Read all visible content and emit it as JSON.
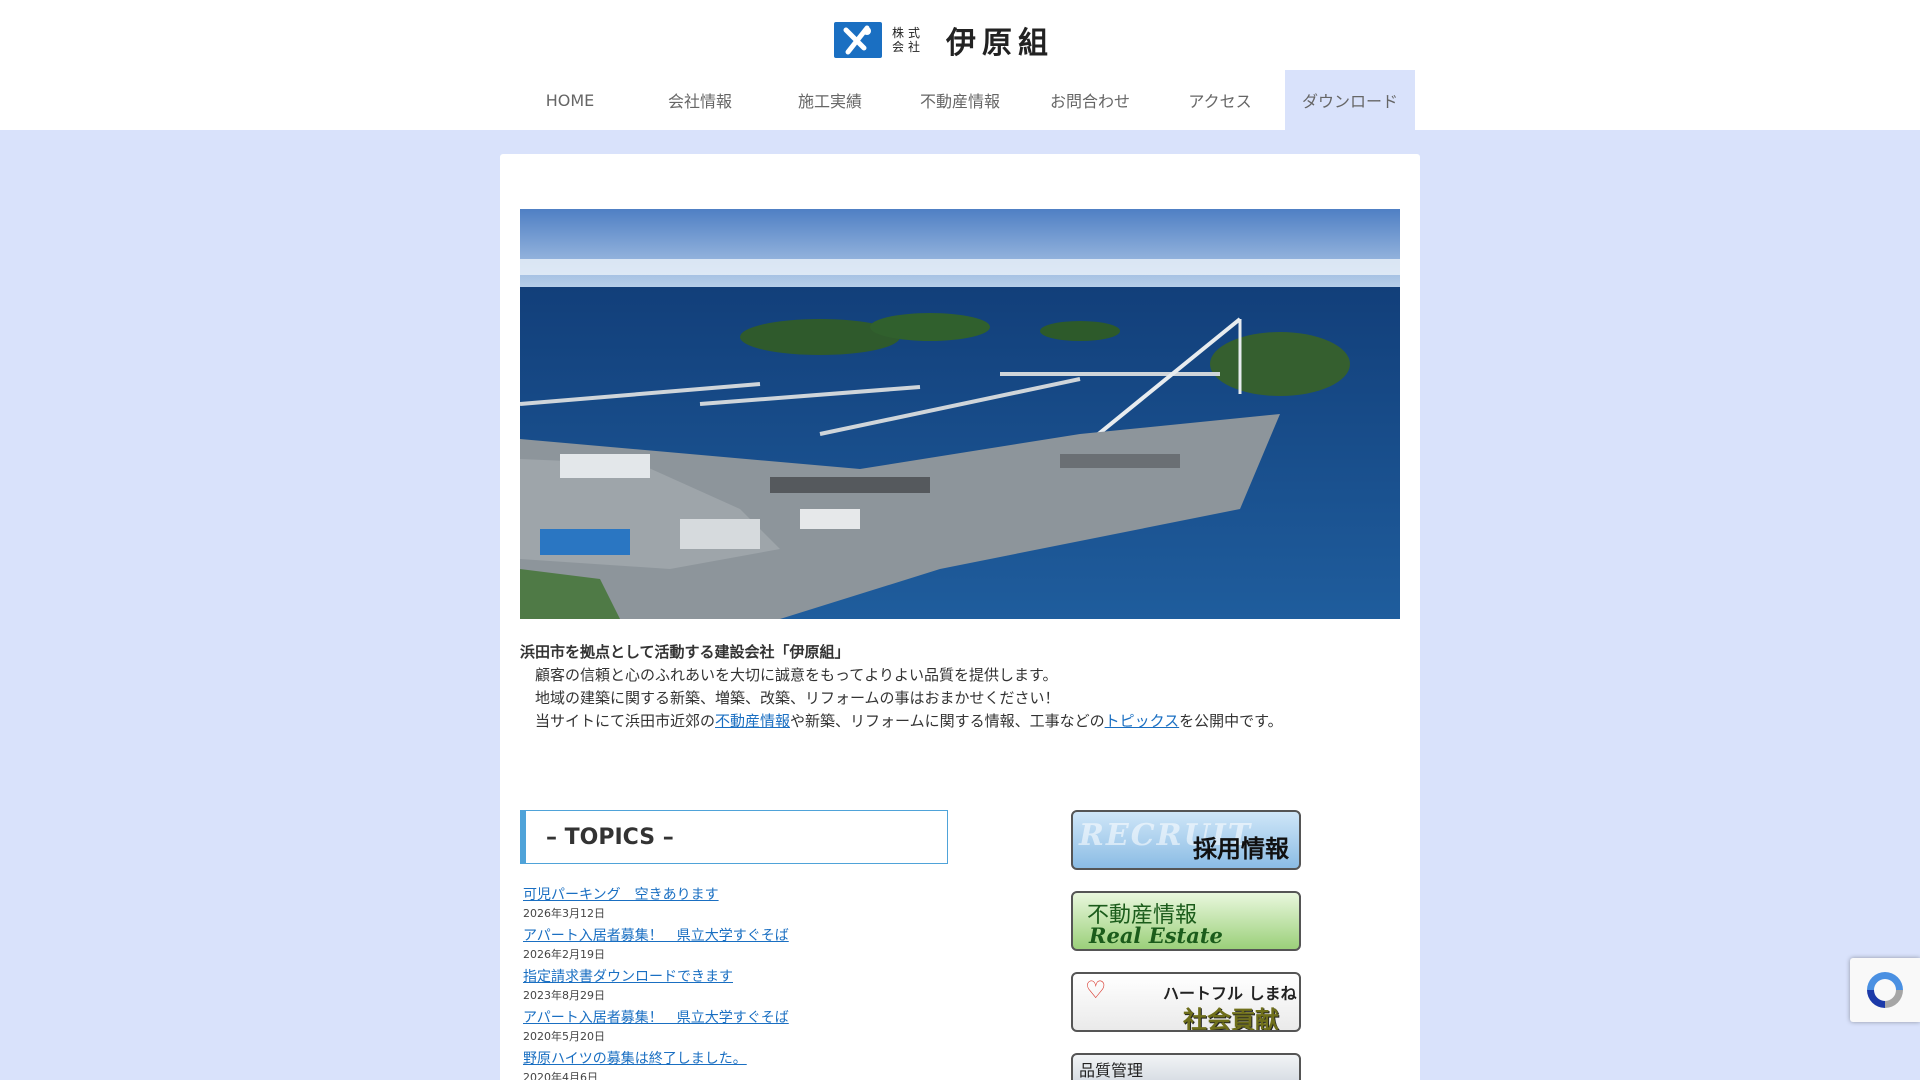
{
  "header": {
    "logo": {
      "kk_line1": "株式",
      "kk_line2": "会社",
      "name": "伊原組"
    },
    "nav": [
      {
        "label": "HOME",
        "active": false
      },
      {
        "label": "会社情報",
        "active": false
      },
      {
        "label": "施工実績",
        "active": false
      },
      {
        "label": "不動産情報",
        "active": false
      },
      {
        "label": "お問合わせ",
        "active": false
      },
      {
        "label": "アクセス",
        "active": false
      },
      {
        "label": "ダウンロード",
        "active": true
      }
    ]
  },
  "intro": {
    "lead": "浜田市を拠点として活動する建設会社「伊原組」",
    "line1": "顧客の信頼と心のふれあいを大切に誠意をもってよりよい品質を提供します。",
    "line2": "地域の建築に関する新築、増築、改築、リフォームの事はおまかせください！",
    "line3_part1": "当サイトにて浜田市近郊の",
    "line3_link1": "不動産情報",
    "line3_part2": "や新築、リフォームに関する情報、工事などの",
    "line3_link2": "トピックス",
    "line3_part3": "を公開中です。"
  },
  "topics": {
    "heading": "– TOPICS –",
    "items": [
      {
        "title": "可児パーキング　空きあります",
        "date": "2026年3月12日"
      },
      {
        "title": "アパート入居者募集！　県立大学すぐそば",
        "date": "2026年2月19日"
      },
      {
        "title": "指定請求書ダウンロードできます",
        "date": "2023年8月29日"
      },
      {
        "title": "アパート入居者募集！　県立大学すぐそば",
        "date": "2020年5月20日"
      },
      {
        "title": "野原ハイツの募集は終了しました。",
        "date": "2020年4月6日"
      }
    ]
  },
  "banners": {
    "recruit": {
      "watermark": "RECRUIT",
      "label": "採用情報"
    },
    "estate": {
      "label_jp": "不動産情報",
      "label_en": "Real Estate"
    },
    "heart": {
      "label_top": "ハートフル しまね",
      "label_main": "社会貢献"
    },
    "quality": {
      "label": "品質管理"
    }
  },
  "colors": {
    "page_bg": "#d9e2fb",
    "accent": "#1a6fc2",
    "topics_border": "#4fa3d9"
  },
  "icons": {
    "logo": "company-logo-mark-icon",
    "recaptcha": "recaptcha-icon"
  }
}
